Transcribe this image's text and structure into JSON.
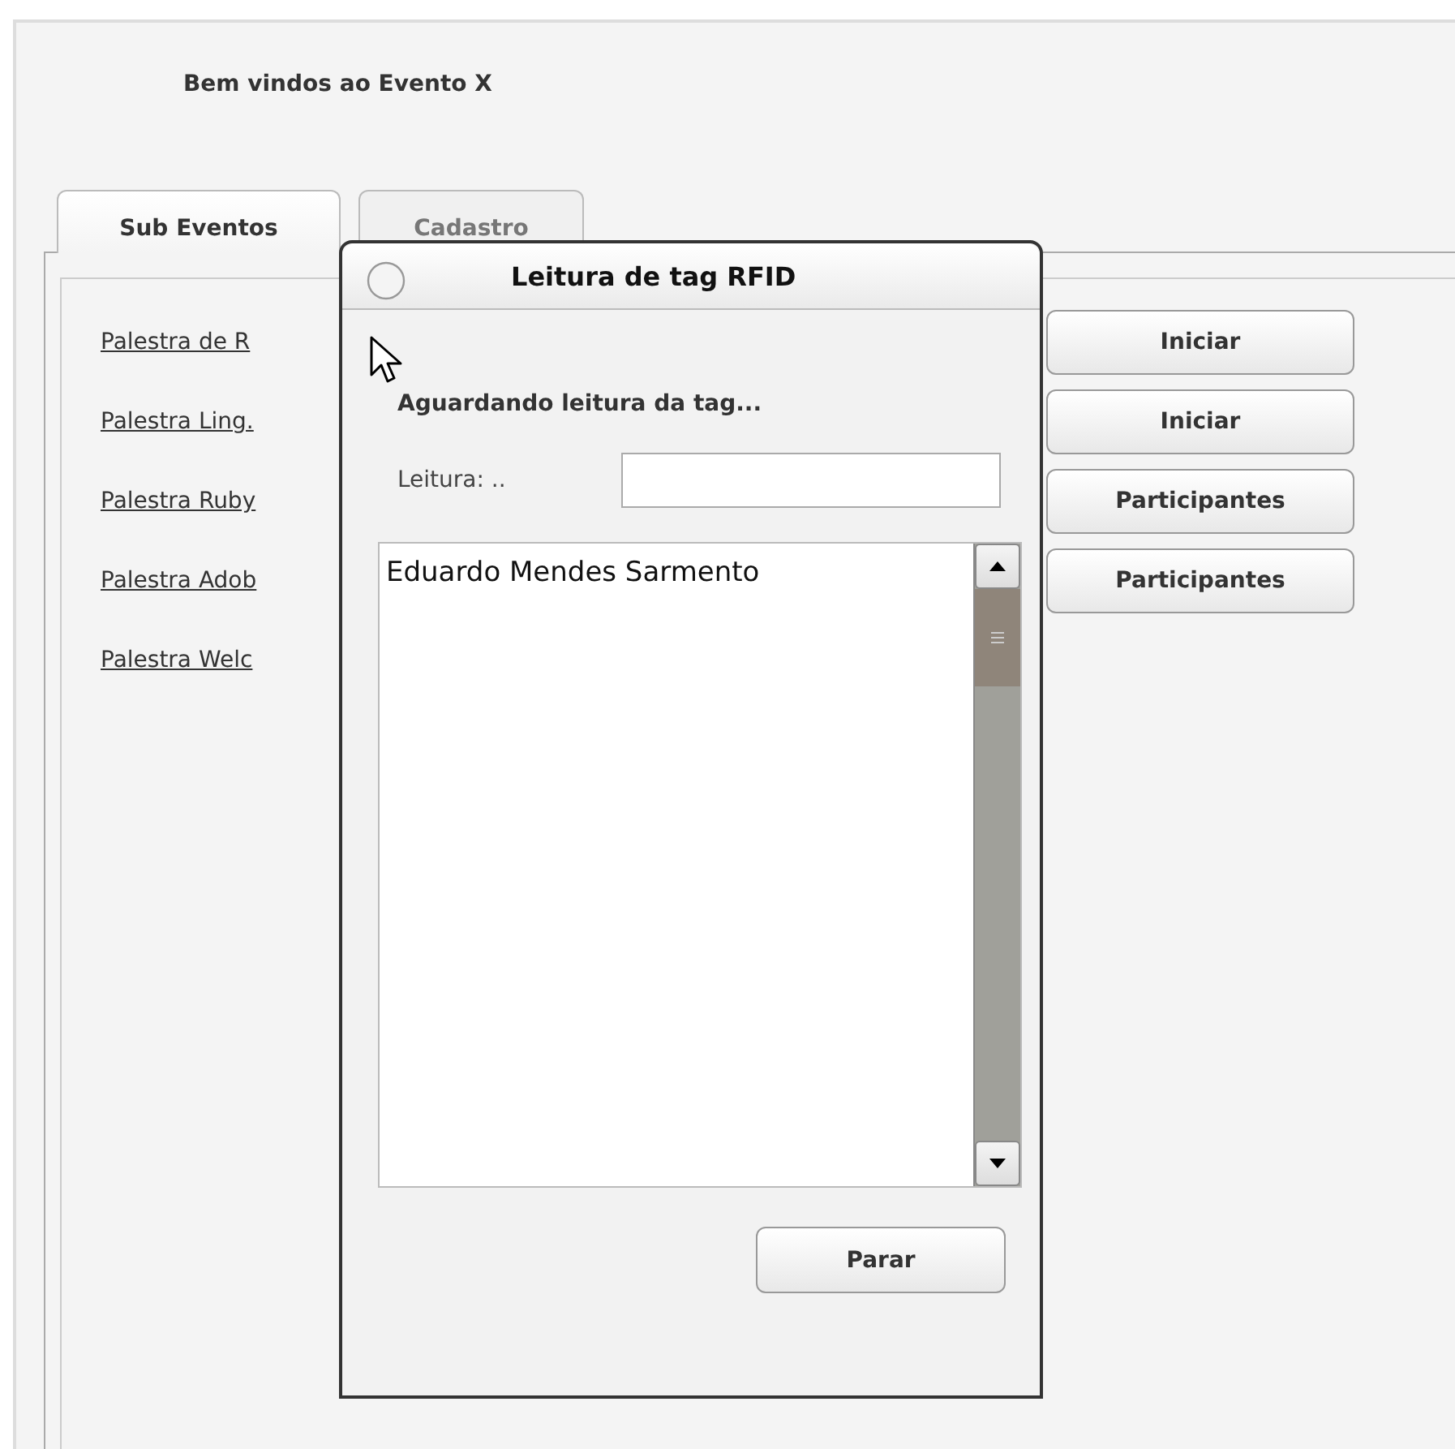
{
  "window": {
    "heading": "Bem vindos ao Evento X"
  },
  "tabs": [
    {
      "label": "Sub Eventos",
      "selected": true
    },
    {
      "label": "Cadastro",
      "selected": false
    }
  ],
  "sub_events": [
    {
      "name": "Palestra de R",
      "action": "Iniciar"
    },
    {
      "name": "Palestra Ling.",
      "action": "Iniciar"
    },
    {
      "name": "Palestra Ruby",
      "action": "Participantes"
    },
    {
      "name": "Palestra Adob",
      "action": "Participantes"
    },
    {
      "name": "Palestra Welc"
    }
  ],
  "dialog": {
    "title": "Leitura de tag RFID",
    "status": "Aguardando leitura da tag...",
    "field": {
      "label": "Leitura: .."
    },
    "list": [
      "Eduardo Mendes Sarmento"
    ],
    "button": "Parar"
  }
}
